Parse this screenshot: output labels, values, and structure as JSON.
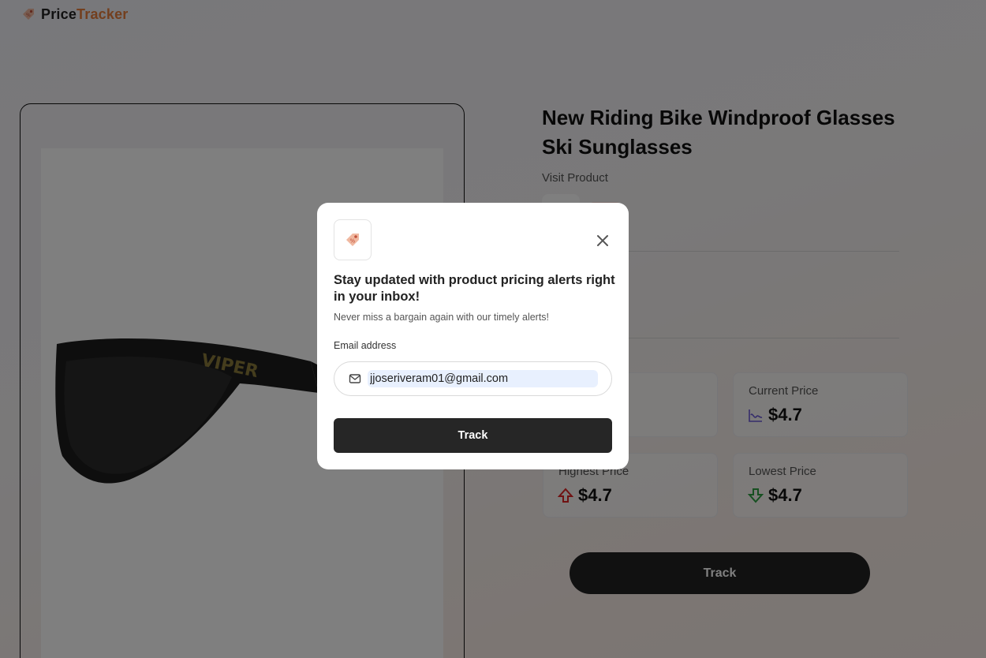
{
  "nav": {
    "brand_part1": "Price",
    "brand_part2": "Tracker"
  },
  "product": {
    "title": "New Riding Bike Windproof Glasses Ski Sunglasses",
    "visit_link": "Visit Product"
  },
  "stats": {
    "current": {
      "label": "Current Price",
      "value": "$4.7",
      "icon": "chart-icon"
    },
    "highest": {
      "label": "Highest Price",
      "value": "$4.7",
      "icon": "arrow-up-icon"
    },
    "lowest": {
      "label": "Lowest Price",
      "value": "$4.7",
      "icon": "arrow-down-icon"
    }
  },
  "main_track_label": "Track",
  "modal": {
    "title": "Stay updated with product pricing alerts right in your inbox!",
    "subtitle": "Never miss a bargain again with our timely alerts!",
    "email_label": "Email address",
    "email_value": "jjoseriveram01@gmail.com",
    "track_label": "Track"
  },
  "colors": {
    "accent": "#e67e3c",
    "dark_button": "#262626",
    "overlay": "rgba(0,0,0,0.5)"
  }
}
